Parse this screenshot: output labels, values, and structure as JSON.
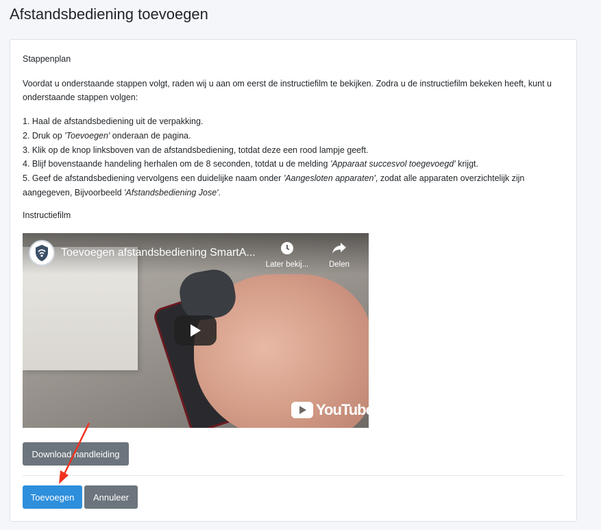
{
  "page": {
    "title": "Afstandsbediening toevoegen"
  },
  "card": {
    "stappenplan_label": "Stappenplan",
    "intro": "Voordat u onderstaande stappen volgt, raden wij u aan om eerst de instructiefilm te bekijken. Zodra u de instructiefilm bekeken heeft, kunt u onderstaande stappen volgen:",
    "steps": [
      {
        "pre": "1. Haal de afstandsbediening uit de verpakking.",
        "em": "",
        "post": ""
      },
      {
        "pre": "2. Druk op ",
        "em": "'Toevoegen'",
        "post": " onderaan de pagina."
      },
      {
        "pre": "3. Klik op de knop linksboven van de afstandsbediening, totdat deze een rood lampje geeft.",
        "em": "",
        "post": ""
      },
      {
        "pre": "4. Blijf bovenstaande handeling herhalen om de 8 seconden, totdat u de melding ",
        "em": "'Apparaat succesvol toegevoegd'",
        "post": " krijgt."
      },
      {
        "pre": "5. Geef de afstandsbediening vervolgens een duidelijke naam onder ",
        "em": "'Aangesloten apparaten'",
        "post": ", zodat alle apparaten overzichtelijk zijn aangegeven, Bijvoorbeeld ",
        "em2": "'Afstandsbediening Jose'",
        "post2": "."
      }
    ],
    "instructiefilm_label": "Instructiefilm",
    "video": {
      "title": "Toevoegen afstandsbediening SmartA...",
      "watch_later": "Later bekij...",
      "share": "Delen",
      "brand": "YouTube"
    },
    "download_button": "Download handleiding",
    "add_button": "Toevoegen",
    "cancel_button": "Annuleer"
  },
  "colors": {
    "primary": "#2e8fdc",
    "secondary": "#6c757d",
    "annotation_arrow": "#f0321e",
    "youtube_red": "#ffffff"
  },
  "icons": [
    "shield-wifi-icon",
    "clock-icon",
    "share-icon",
    "play-icon",
    "youtube-logo-icon",
    "annotation-arrow"
  ]
}
